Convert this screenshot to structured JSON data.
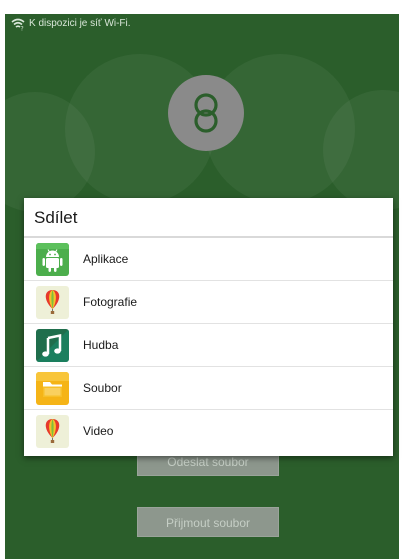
{
  "statusbar": {
    "wifi_icon": "wifi-icon",
    "notification": "K dispozici je síť Wi-Fi."
  },
  "background": {
    "logo_icon": "linked-rings-icon",
    "send_button": "Odeslat soubor",
    "receive_button": "Přijmout soubor",
    "colors": {
      "background": "#2b5e2b",
      "logo_circle": "#8a8a8a",
      "button": "#8d978d"
    }
  },
  "dialog": {
    "title": "Sdílet",
    "items": [
      {
        "label": "Aplikace",
        "icon": "android-icon"
      },
      {
        "label": "Fotografie",
        "icon": "balloon-photo-icon"
      },
      {
        "label": "Hudba",
        "icon": "music-note-icon"
      },
      {
        "label": "Soubor",
        "icon": "folder-icon"
      },
      {
        "label": "Video",
        "icon": "balloon-video-icon"
      }
    ]
  }
}
